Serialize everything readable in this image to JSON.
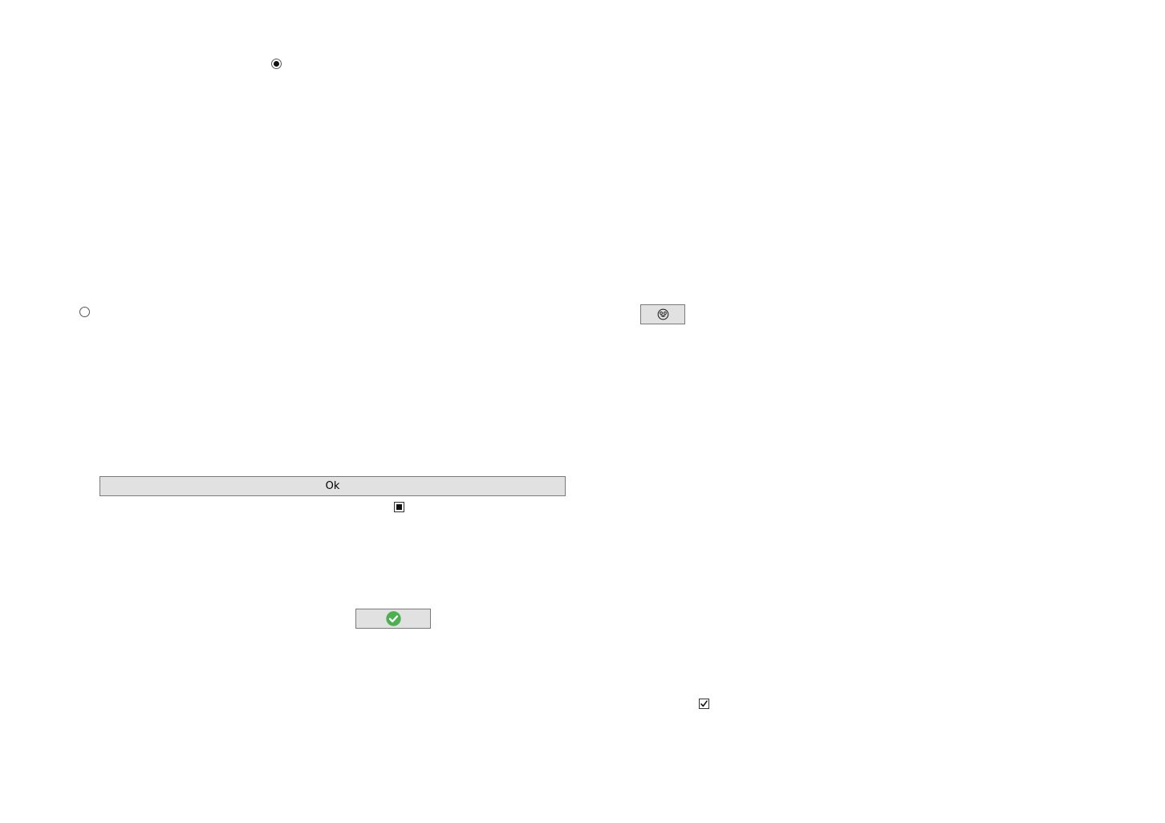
{
  "controls": {
    "radio_top": {
      "checked": true
    },
    "radio_left": {
      "checked": false
    },
    "ok_button": {
      "label": "Ok"
    },
    "checkbox_indeterminate": {
      "state": "indeterminate"
    },
    "check_button": {
      "icon": "green-check-circle-icon",
      "color": "#4caf50"
    },
    "emoji_button": {
      "icon": "smiley-face-icon"
    },
    "checkbox_checked": {
      "state": "checked"
    }
  }
}
